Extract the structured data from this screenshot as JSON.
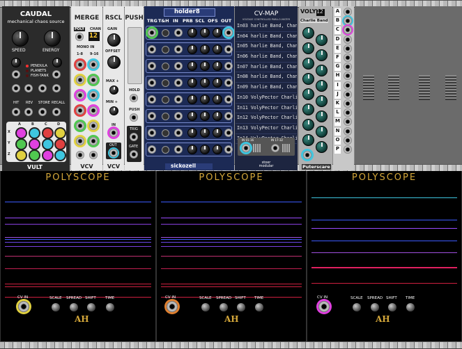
{
  "caudal": {
    "title": "CAUDAL",
    "subtitle": "mechanical chaos source",
    "speed": "SPEED",
    "energy": "ENERGY",
    "modes": [
      "PENDULA",
      "PLANETS",
      "FISH-TANK"
    ],
    "buttons": [
      "HIT",
      "REV",
      "STORE",
      "RECALL"
    ],
    "matrix_cols": [
      "A",
      "B",
      "C",
      "D"
    ],
    "matrix_rows": [
      "X",
      "Y",
      "Z"
    ],
    "brand": "VULT"
  },
  "merge": {
    "title": "MERGE",
    "poly": "POLY",
    "chan": "CHAN",
    "chan_value": "12",
    "mono_in": "MONO IN",
    "range_a": "1-8",
    "range_b": "9-16",
    "brand": "VCV"
  },
  "rscl": {
    "title": "RSCL",
    "gain": "GAIN",
    "offset": "OFFSET",
    "max": "MAX +",
    "min": "MIN +",
    "in": "IN",
    "out": "OUT",
    "brand": "VCV"
  },
  "push": {
    "title": "PUSH",
    "hold": "HOLD",
    "push": "PUSH",
    "trig": "TRIG",
    "gate": "GATE"
  },
  "holder": {
    "title": "holder8",
    "cols": [
      "TRG",
      "T&H",
      "IN",
      "PRB",
      "SCL",
      "OFS",
      "OUT"
    ],
    "brand": "sickozell"
  },
  "cvmap": {
    "title": "CV-MAP",
    "subtitle": "VOLTAGE CONTROLLED PARA-O-MATER",
    "rows": [
      "In03 harlie Band, Channe",
      "In04 harlie Band, Channe",
      "In05 harlie Band, Channe",
      "In06 harlie Band, Channe",
      "In07 harlie Band, Channe",
      "In08 harlie Band, Channe",
      "In09 harlie Band, Channe",
      "In10 VolyPector Charlie",
      "In11 VolyPector Charlie",
      "In12 VolyPector Charlie",
      "In13 VolyPector Charlie",
      "In14 VolyPector Charlie"
    ],
    "in1": "IN 01-16",
    "in2": "IN 17-32",
    "brand": "stoer\nmodular"
  },
  "voly": {
    "title": "VOLY",
    "subtitle": "Charlie Band",
    "chan": "12",
    "brand": "Puterscare",
    "letters": [
      "A",
      "B",
      "C",
      "D",
      "E",
      "F",
      "G",
      "H",
      "I",
      "J",
      "K",
      "L",
      "M",
      "N",
      "O",
      "P"
    ]
  },
  "polyscope": [
    {
      "title": "POLYSCOPE",
      "cv_in": "CV IN",
      "scale": "SCALE",
      "spread": "SPREAD",
      "shift": "SHIFT",
      "time": "TIME",
      "brand": "AH"
    },
    {
      "title": "POLYSCOPE",
      "cv_in": "CV IN",
      "scale": "SCALE",
      "spread": "SPREAD",
      "shift": "SHIFT",
      "time": "TIME",
      "brand": "AH"
    },
    {
      "title": "POLYSCOPE",
      "cv_in": "CV IN",
      "scale": "SCALE",
      "spread": "SPREAD",
      "shift": "SHIFT",
      "time": "TIME",
      "brand": "AH"
    }
  ],
  "colors": {
    "scope_gold": "#d4a73a",
    "cvmap_bg": "#1d2540",
    "holder_bg": "#1c2a55"
  }
}
